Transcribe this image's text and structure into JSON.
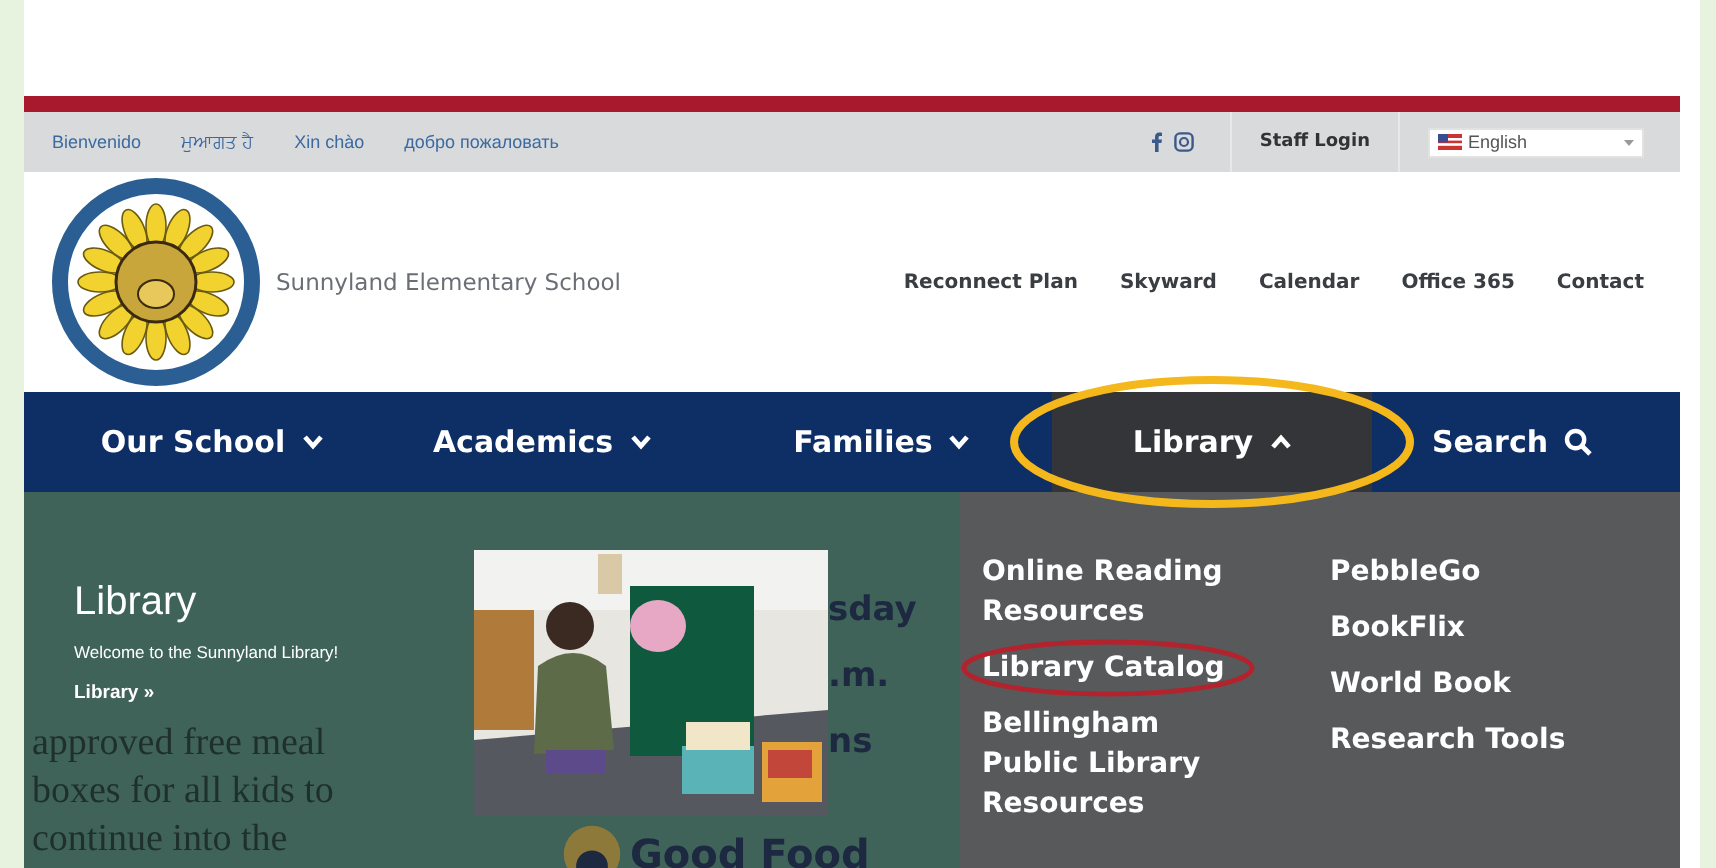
{
  "top_bar": {
    "languages": [
      "Bienvenido",
      "ਮੁਆਗਤ ਹੈ",
      "Xin chào",
      "добро пожаловать"
    ],
    "staff_login": "Staff Login",
    "language_select": {
      "value": "English"
    }
  },
  "header": {
    "school_name": "Sunnyland Elementary School",
    "links": [
      "Reconnect Plan",
      "Skyward",
      "Calendar",
      "Office 365",
      "Contact"
    ]
  },
  "nav": [
    {
      "label": "Our School",
      "kind": "dropdown",
      "selected": false,
      "circled": false
    },
    {
      "label": "Academics",
      "kind": "dropdown",
      "selected": false,
      "circled": false
    },
    {
      "label": "Families",
      "kind": "dropdown",
      "selected": false,
      "circled": false
    },
    {
      "label": "Library",
      "kind": "dropdown",
      "selected": true,
      "circled": true
    },
    {
      "label": "Search",
      "kind": "search",
      "selected": false,
      "circled": false
    }
  ],
  "background": {
    "meals_lines": [
      "approved free meal",
      "boxes for all kids to",
      "continue into the"
    ],
    "middle_lines": [
      "sday",
      ".m.",
      "ns"
    ],
    "good_food": "Good Food"
  },
  "library_menu": {
    "title": "Library",
    "welcome": "Welcome to the Sunnyland Library!",
    "more": "Library »",
    "columns": [
      [
        {
          "label": "Online Reading Resources",
          "circled": false
        },
        {
          "label": "Library Catalog",
          "circled": true
        },
        {
          "label": "Bellingham Public Library Resources",
          "circled": false
        }
      ],
      [
        {
          "label": "PebbleGo",
          "circled": false
        },
        {
          "label": "BookFlix",
          "circled": false
        },
        {
          "label": "World Book",
          "circled": false
        },
        {
          "label": "Research Tools",
          "circled": false
        }
      ]
    ]
  }
}
